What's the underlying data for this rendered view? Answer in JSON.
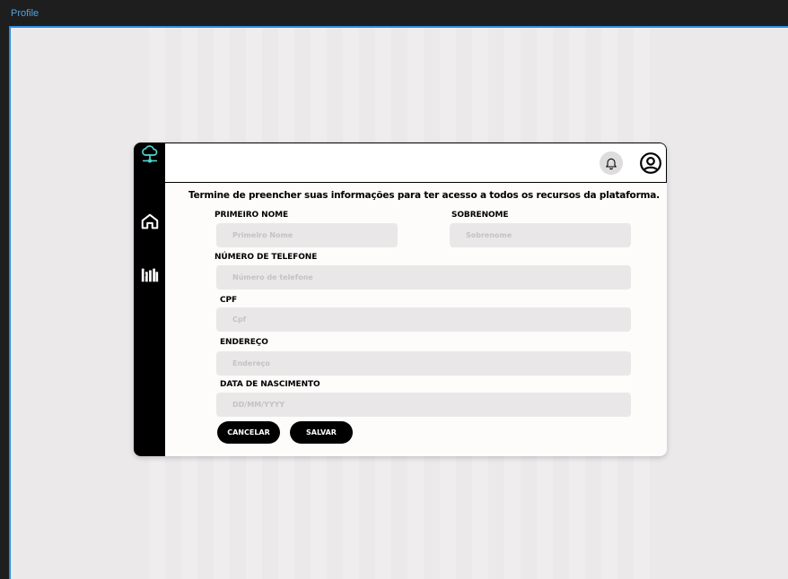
{
  "window": {
    "frame_label": "Profile"
  },
  "header": {
    "bell_icon": "bell-icon",
    "user_icon": "user-circle-icon"
  },
  "sidebar": {
    "items": [
      {
        "icon": "cloud-network-icon"
      },
      {
        "icon": "home-icon"
      },
      {
        "icon": "library-icon"
      }
    ],
    "accent": "#4fd6d0"
  },
  "form": {
    "heading": "Termine de preencher suas informações para ter acesso a todos os recursos da plataforma.",
    "first_name": {
      "label": "PRIMEIRO NOME",
      "placeholder": "Primeiro Nome"
    },
    "last_name": {
      "label": "SOBRENOME",
      "placeholder": "Sobrenome"
    },
    "phone": {
      "label": "NÚMERO DE TELEFONE",
      "placeholder": "Número de telefone"
    },
    "cpf": {
      "label": "CPF",
      "placeholder": "Cpf"
    },
    "address": {
      "label": "ENDEREÇO",
      "placeholder": "Endereço"
    },
    "birthdate": {
      "label": "DATA DE NASCIMENTO",
      "placeholder": "DD/MM/YYYY"
    },
    "cancel_label": "CANCELAR",
    "save_label": "SALVAR"
  }
}
